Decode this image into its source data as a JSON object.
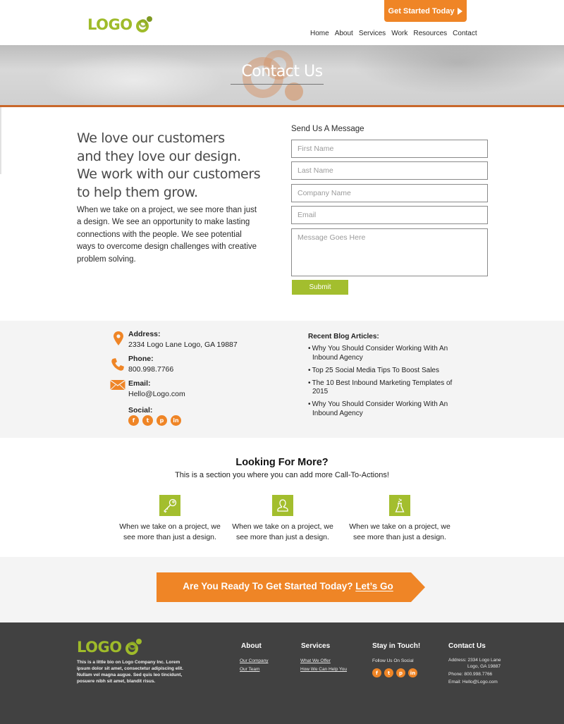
{
  "header": {
    "logo_text": "LOGO",
    "cta_label": "Get Started Today",
    "nav": [
      "Home",
      "About",
      "Services",
      "Work",
      "Resources",
      "Contact"
    ]
  },
  "hero": {
    "title": "Contact Us"
  },
  "intro": {
    "heading_lines": [
      "We love our customers",
      "and they love our design.",
      "We work with our customers",
      "to help them grow."
    ],
    "body": "When we take on a project, we see more than just a design. We see an opportunity to make lasting connections with the people. We see potential ways to overcome design challenges with creative problem solving."
  },
  "form": {
    "title": "Send Us A Message",
    "fields": [
      {
        "placeholder": "First Name",
        "value": ""
      },
      {
        "placeholder": "Last Name",
        "value": ""
      },
      {
        "placeholder": "Company Name",
        "value": ""
      },
      {
        "placeholder": "Email",
        "value": ""
      }
    ],
    "message_placeholder": "Message Goes Here",
    "submit_label": "Submit"
  },
  "contact_info": {
    "address_label": "Address:",
    "address_value": "2334 Logo Lane Logo, GA 19887",
    "phone_label": "Phone:",
    "phone_value": "800.998.7766",
    "email_label": "Email:",
    "email_value": "Hello@Logo.com",
    "social_label": "Social:",
    "social": [
      {
        "name": "facebook",
        "glyph": "f"
      },
      {
        "name": "twitter",
        "glyph": "t"
      },
      {
        "name": "pinterest",
        "glyph": "p"
      },
      {
        "name": "linkedin",
        "glyph": "in"
      }
    ]
  },
  "blog": {
    "title": "Recent Blog Articles:",
    "articles": [
      "Why You Should Consider Working With An Inbound Agency",
      "Top 25 Social Media Tips To Boost Sales",
      "The 10 Best Inbound Marketing Templates of 2015",
      "Why You Should Consider Working With An Inbound Agency"
    ]
  },
  "more": {
    "title": "Looking For More?",
    "subtitle": "This is a section you where you can add more Call-To-Actions!",
    "cards": [
      {
        "icon": "key-icon",
        "text": "When we take on a project, we see more than just a design."
      },
      {
        "icon": "user-icon",
        "text": "When we take on a project, we see more than just a design."
      },
      {
        "icon": "flask-icon",
        "text": "When we take on a project, we see more than just a design."
      }
    ]
  },
  "get_started": {
    "text": "Are You Ready To Get Started Today?",
    "link": "Let’s Go"
  },
  "footer": {
    "logo_text": "LOGO",
    "bio": "This is a little bio on Logo Company Inc.  Lorem ipsum dolor sit amet, consectetur adipiscing elit. Nullam vel magna augue. Sed quis leo tincidunt, posuere nibh sit amet, blandit risus.",
    "about_title": "About",
    "about_links": [
      "Our Company",
      "Our Team"
    ],
    "services_title": "Services",
    "services_links": [
      "What We Offer",
      "How We Can Help You"
    ],
    "touch_title": "Stay in Touch!",
    "touch_text": "Follow Us On Social",
    "contact_title": "Contact Us",
    "contact_address_1": "Address: 2334 Logo Lane",
    "contact_address_2": "Logo, GA 19887",
    "contact_phone": "Phone: 800.998.7766",
    "contact_email": "Email: Hello@Logo.com"
  },
  "colors": {
    "brand_green": "#a3be2e",
    "brand_orange": "#ef8526",
    "accent_rust": "#c8672a",
    "footer_bg": "#414141",
    "band_bg": "#f4f4f4"
  }
}
